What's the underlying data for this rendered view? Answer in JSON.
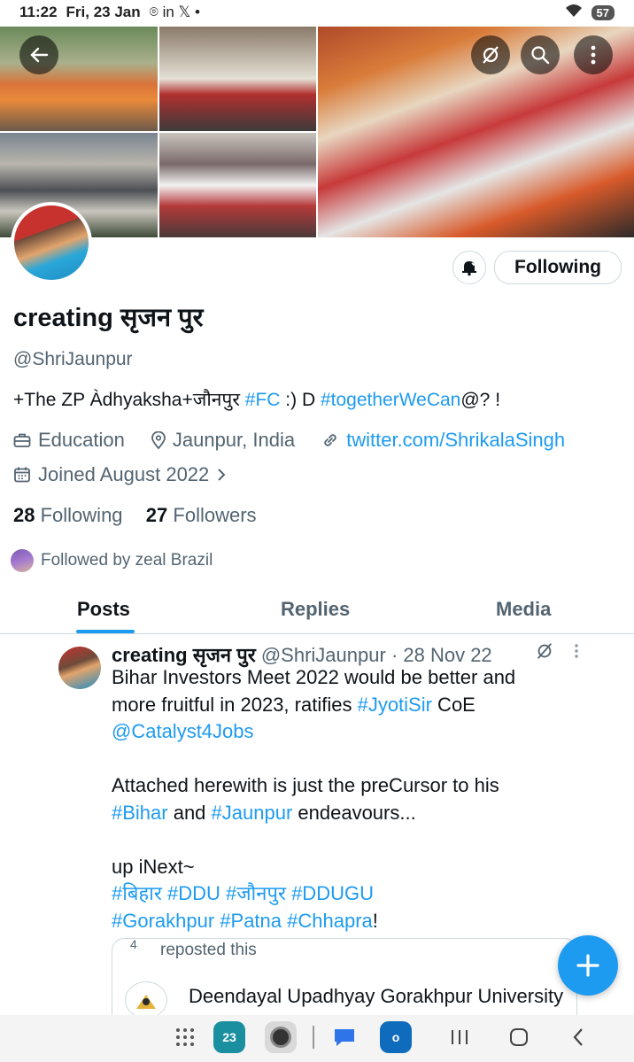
{
  "status_bar": {
    "time": "11:22",
    "date": "Fri, 23 Jan",
    "notification_icons": "⌾ in 𝕏 •",
    "wifi_icon": "wifi-icon",
    "battery_level": "57"
  },
  "profile": {
    "name": "creating सृजन पुर",
    "handle": "@ShriJaunpur",
    "bio": {
      "part1": "+The ZP Àdhyaksha+जौनपुर ",
      "tag1": "#FC",
      "part2": " :) D ",
      "tag2": "#togetherWeCan",
      "part3": "@? !"
    },
    "category": "Education",
    "location": "Jaunpur, India",
    "website": "twitter.com/ShrikalaSingh",
    "joined": "Joined August 2022",
    "following_count": "28",
    "following_label": "Following",
    "followers_count": "27",
    "followers_label": "Followers",
    "followed_by": "Followed by zeal Brazil",
    "follow_button_label": "Following"
  },
  "tabs": [
    {
      "label": "Posts",
      "active": true
    },
    {
      "label": "Replies",
      "active": false
    },
    {
      "label": "Media",
      "active": false
    }
  ],
  "post": {
    "author_name": "creating सृजन पुर",
    "author_handle": "@ShriJaunpur",
    "date": "· 28 Nov 22",
    "lines": [
      {
        "parts": [
          {
            "t": "Bihar Investors Meet 2022 would be better and",
            "link": false
          }
        ]
      },
      {
        "parts": [
          {
            "t": "more fruitful in 2023, ratifies ",
            "link": false
          },
          {
            "t": "#JyotiSir",
            "link": true
          },
          {
            "t": " CoE",
            "link": false
          }
        ]
      },
      {
        "parts": [
          {
            "t": "@Catalyst4Jobs",
            "link": true
          }
        ]
      },
      {
        "parts": [
          {
            "t": "",
            "link": false
          }
        ]
      },
      {
        "parts": [
          {
            "t": "Attached herewith is just the preCursor to his",
            "link": false
          }
        ]
      },
      {
        "parts": [
          {
            "t": "#Bihar",
            "link": true
          },
          {
            "t": " and ",
            "link": false
          },
          {
            "t": "#Jaunpur",
            "link": true
          },
          {
            "t": " endeavours...",
            "link": false
          }
        ]
      },
      {
        "parts": [
          {
            "t": "",
            "link": false
          }
        ]
      },
      {
        "parts": [
          {
            "t": "up iNext~",
            "link": false
          }
        ]
      },
      {
        "parts": [
          {
            "t": "#बिहार #DDU #जौनपुर #DDUGU",
            "link": true
          }
        ]
      },
      {
        "parts": [
          {
            "t": "#Gorakhpur #Patna #Chhapra",
            "link": true
          },
          {
            "t": "!",
            "link": false
          }
        ]
      }
    ],
    "quote": {
      "line1": "reposted this",
      "title": "Deendayal Upadhyay Gorakhpur University"
    }
  },
  "colors": {
    "accent": "#1d9bf0",
    "text": "#0f1419",
    "muted": "#536471"
  }
}
